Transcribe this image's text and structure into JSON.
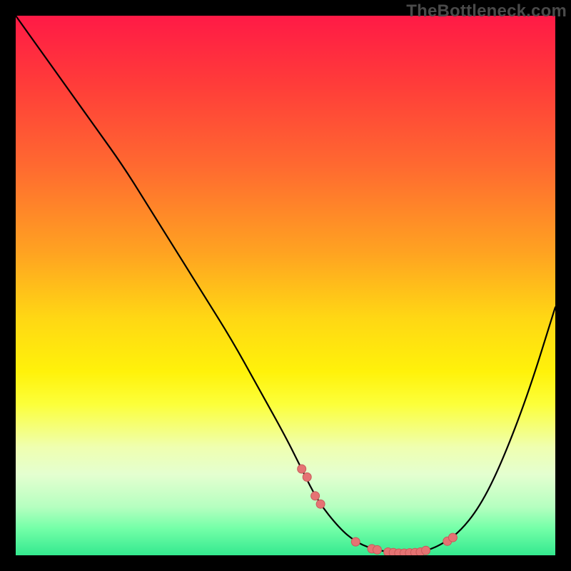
{
  "watermark": "TheBottleneck.com",
  "colors": {
    "curve_stroke": "#000000",
    "marker_fill": "#e57373",
    "marker_stroke": "#c85a5a",
    "background": "#000000"
  },
  "chart_data": {
    "type": "line",
    "title": "",
    "xlabel": "",
    "ylabel": "",
    "xlim": [
      0,
      100
    ],
    "ylim": [
      0,
      100
    ],
    "grid": false,
    "legend": false,
    "series": [
      {
        "name": "bottleneck-curve",
        "x": [
          0,
          5,
          10,
          15,
          20,
          25,
          30,
          35,
          40,
          45,
          50,
          53,
          56,
          60,
          63,
          66,
          69,
          72,
          75,
          78,
          82,
          86,
          90,
          95,
          100
        ],
        "y": [
          100,
          93,
          86,
          79,
          72,
          64,
          56,
          48,
          40,
          31,
          22,
          16,
          10,
          5,
          2.5,
          1.2,
          0.6,
          0.4,
          0.6,
          1.5,
          4,
          9,
          17,
          30,
          46
        ]
      }
    ],
    "markers": {
      "description": "highlighted points along the curve",
      "x": [
        53,
        54,
        55.5,
        56.5,
        63,
        66,
        67,
        69,
        70,
        71,
        72,
        73,
        74,
        75,
        76,
        80,
        81
      ],
      "y": [
        16,
        14.5,
        11,
        9.5,
        2.5,
        1.2,
        1.0,
        0.6,
        0.5,
        0.4,
        0.4,
        0.45,
        0.5,
        0.6,
        0.9,
        2.6,
        3.3
      ],
      "style": {
        "shape": "circle",
        "radius_px": 6,
        "fill": "#e57373",
        "stroke": "#c85a5a"
      }
    }
  }
}
